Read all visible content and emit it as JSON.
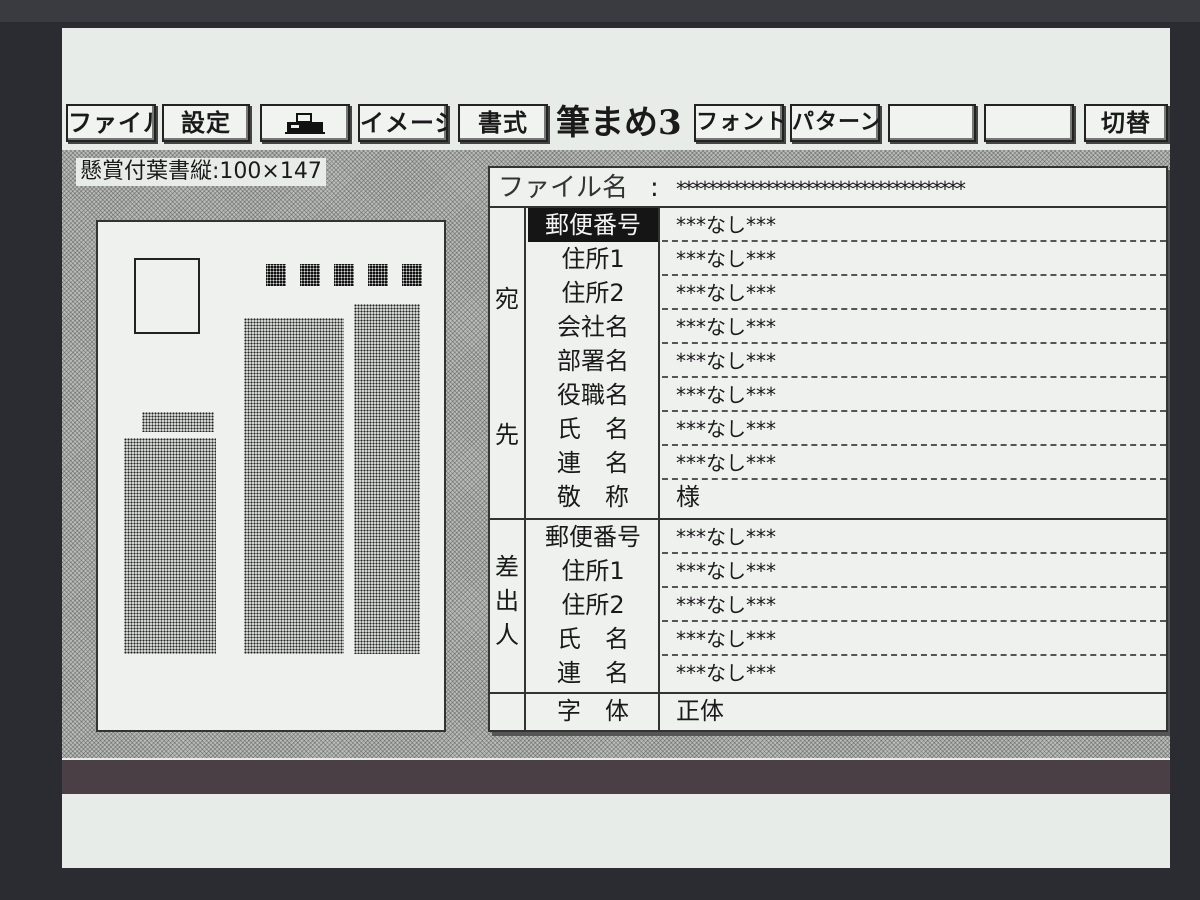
{
  "menu": {
    "items": [
      {
        "id": "file",
        "label": "ファイル"
      },
      {
        "id": "settings",
        "label": "設定"
      },
      {
        "id": "print",
        "label": ""
      },
      {
        "id": "image",
        "label": "イメージ"
      },
      {
        "id": "format",
        "label": "書式"
      },
      {
        "id": "font",
        "label": "フォント"
      },
      {
        "id": "pattern",
        "label": "パターン"
      },
      {
        "id": "blank1",
        "label": ""
      },
      {
        "id": "blank2",
        "label": ""
      },
      {
        "id": "switch",
        "label": "切替"
      }
    ],
    "app_title": "筆まめ3"
  },
  "card": {
    "label": "懸賞付葉書縦:100×147"
  },
  "form": {
    "file_label": "ファイル名",
    "file_colon": ":",
    "file_value": "************************************",
    "recipient": {
      "side_chars": [
        "宛",
        "先"
      ],
      "rows": [
        {
          "label": "郵便番号",
          "value": "***なし***",
          "selected": true
        },
        {
          "label": "住所1",
          "value": "***なし***"
        },
        {
          "label": "住所2",
          "value": "***なし***"
        },
        {
          "label": "会社名",
          "value": "***なし***"
        },
        {
          "label": "部署名",
          "value": "***なし***"
        },
        {
          "label": "役職名",
          "value": "***なし***"
        },
        {
          "label": "氏　名",
          "value": "***なし***"
        },
        {
          "label": "連　名",
          "value": "***なし***"
        },
        {
          "label": "敬　称",
          "value": "様"
        }
      ]
    },
    "sender": {
      "side_chars": [
        "差",
        "出",
        "人"
      ],
      "rows": [
        {
          "label": "郵便番号",
          "value": "***なし***"
        },
        {
          "label": "住所1",
          "value": "***なし***"
        },
        {
          "label": "住所2",
          "value": "***なし***"
        },
        {
          "label": "氏　名",
          "value": "***なし***"
        },
        {
          "label": "連　名",
          "value": "***なし***"
        }
      ]
    },
    "font_row": {
      "label": "字　体",
      "value": "正体"
    }
  }
}
